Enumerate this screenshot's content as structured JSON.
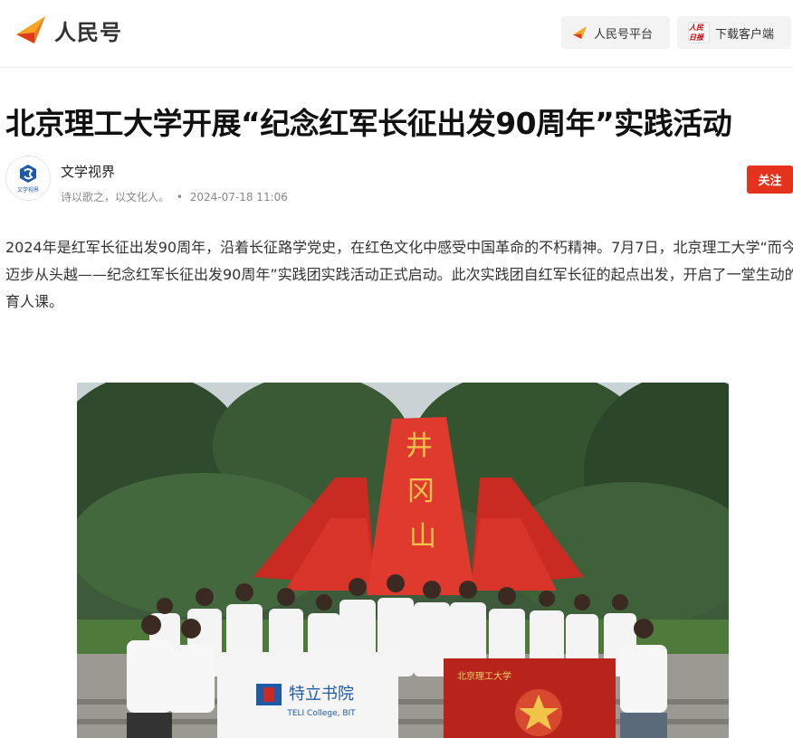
{
  "header": {
    "logo_text": "人民号",
    "platform_label": "人民号平台",
    "download_label": "下载客户端",
    "download_icon_text": "人民日报"
  },
  "article": {
    "title": "北京理工大学开展“纪念红军长征出发90周年”实践活动",
    "author": {
      "name": "文学视界",
      "avatar_caption": "文学视界",
      "bio": "诗以歌之，以文化人。",
      "date": "2024-07-18 11:06",
      "follow_label": "关注"
    },
    "paragraph": "2024年是红军长征出发90周年，沿着长征路学党史，在红色文化中感受中国革命的不朽精神。7月7日，北京理工大学“而今迈步从头越——纪念红军长征出发90周年”实践团实践活动正式启动。此次实践团自红军长征的起点出发，开启了一堂生动的育人课。",
    "photo": {
      "monument_text": "井冈山",
      "banner_left_cn": "特立书院",
      "banner_left_en": "TELI College, BIT",
      "banner_right_cn": "北京理工大学"
    }
  },
  "colors": {
    "accent": "#e4321d",
    "logo_orange": "#f5a623",
    "logo_red": "#e03a1e"
  }
}
